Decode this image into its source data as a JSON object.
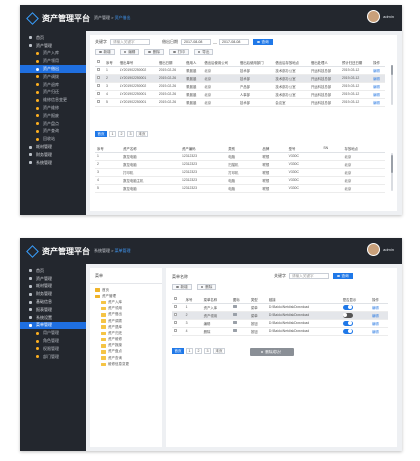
{
  "app": {
    "logo_text": "资产管理平台",
    "user_name": "admin"
  },
  "panel1": {
    "breadcrumb": {
      "parent": "资产管理",
      "sep": " > ",
      "current": "资产借出"
    },
    "sidebar": [
      {
        "label": "首页",
        "sub": false,
        "active": false
      },
      {
        "label": "资产管理",
        "sub": false,
        "active": false
      },
      {
        "label": "资产入库",
        "sub": true,
        "active": false
      },
      {
        "label": "资产领用",
        "sub": true,
        "active": false
      },
      {
        "label": "资产借出",
        "sub": true,
        "active": true
      },
      {
        "label": "资产调拨",
        "sub": true,
        "active": false
      },
      {
        "label": "资产退库",
        "sub": true,
        "active": false
      },
      {
        "label": "资产归还",
        "sub": true,
        "active": false
      },
      {
        "label": "维修信息变更",
        "sub": true,
        "active": false
      },
      {
        "label": "资产维修",
        "sub": true,
        "active": false
      },
      {
        "label": "资产报废",
        "sub": true,
        "active": false
      },
      {
        "label": "资产盘点",
        "sub": true,
        "active": false
      },
      {
        "label": "资产查询",
        "sub": true,
        "active": false
      },
      {
        "label": "回收站",
        "sub": true,
        "active": false
      },
      {
        "label": "耗材管理",
        "sub": false,
        "active": false
      },
      {
        "label": "财务管理",
        "sub": false,
        "active": false
      },
      {
        "label": "系统管理",
        "sub": false,
        "active": false
      }
    ],
    "filter": {
      "keyword_label": "关键字",
      "keyword_placeholder": "请输入关键字",
      "date_label": "借出日期",
      "date_from": "2017-08-08",
      "date_sep": "—",
      "date_to": "2017-08-08",
      "search_label": "查询"
    },
    "toolbar": [
      "新增",
      "编辑",
      "删除",
      "打印",
      "导出"
    ],
    "table1": {
      "headers": [
        "",
        "序号",
        "借出单号",
        "借出日期",
        "借用人",
        "借出后使用公司",
        "借出后使用部门",
        "借出后存放地点",
        "借出处理人",
        "预计归还日期",
        "操作"
      ],
      "rows": [
        [
          "1",
          "LY201902250002",
          "2019-02-26",
          "董晨晨",
          "北京",
          "技术部",
          "技术部办公室",
          "开运科技总部",
          "2019-03-12",
          "编辑"
        ],
        [
          "2",
          "LY201902250001",
          "2019-02-26",
          "董晨晨",
          "北京",
          "技术部",
          "技术部办公室",
          "开运科技总部",
          "2019-03-12",
          "编辑"
        ],
        [
          "3",
          "LY201902250002",
          "2019-02-26",
          "董晨晨",
          "北京",
          "产品部",
          "技术部办公室",
          "开运科技总部",
          "2019-03-12",
          "编辑"
        ],
        [
          "4",
          "LY201902250001",
          "2019-02-26",
          "董晨晨",
          "北京",
          "人事部",
          "技术部办公室",
          "开运科技总部",
          "2019-03-12",
          "编辑"
        ],
        [
          "5",
          "LY201902250001",
          "2019-02-26",
          "董晨晨",
          "北京",
          "技术部",
          "会议室",
          "开运科技总部",
          "2019-03-12",
          "编辑"
        ]
      ]
    },
    "pagination": {
      "prev": "首页",
      "pages": [
        "1",
        "2",
        "3"
      ],
      "next": "末页"
    },
    "table2": {
      "headers": [
        "序号",
        "资产名称",
        "资产编码",
        "类别",
        "品牌",
        "型号",
        "SN",
        "存放地点"
      ],
      "rows": [
        [
          "1",
          "数控电脑",
          "12312323",
          "电脑",
          "联想",
          "V330C",
          "",
          "北京"
        ],
        [
          "2",
          "数控电脑",
          "12312323",
          "扫描机",
          "联想",
          "V330C",
          "",
          "北京"
        ],
        [
          "3",
          "打印机",
          "12312323",
          "打印机",
          "联想",
          "V330C",
          "",
          "北京"
        ],
        [
          "4",
          "数控电脑主机",
          "12312323",
          "电脑",
          "联想",
          "V330C",
          "",
          "北京"
        ],
        [
          "5",
          "数控电脑",
          "12312323",
          "电脑",
          "联想",
          "V330C",
          "",
          "北京"
        ]
      ]
    }
  },
  "panel2": {
    "breadcrumb": {
      "parent": "系统管理",
      "sep": " > ",
      "current": "菜单管理"
    },
    "sidebar": [
      {
        "label": "首页",
        "sub": false,
        "active": false
      },
      {
        "label": "资产管理",
        "sub": false,
        "active": false
      },
      {
        "label": "耗材管理",
        "sub": false,
        "active": false
      },
      {
        "label": "财务管理",
        "sub": false,
        "active": false
      },
      {
        "label": "基础信息",
        "sub": false,
        "active": false
      },
      {
        "label": "报表管理",
        "sub": false,
        "active": false
      },
      {
        "label": "系统设置",
        "sub": false,
        "active": false
      },
      {
        "label": "菜单管理",
        "sub": false,
        "active": true
      },
      {
        "label": "用户管理",
        "sub": true,
        "active": false
      },
      {
        "label": "角色管理",
        "sub": true,
        "active": false
      },
      {
        "label": "权限管理",
        "sub": true,
        "active": false
      },
      {
        "label": "部门管理",
        "sub": true,
        "active": false
      }
    ],
    "tree": {
      "title": "菜单",
      "nodes": [
        {
          "label": "首页",
          "level": 0
        },
        {
          "label": "资产管理",
          "level": 0
        },
        {
          "label": "资产入库",
          "level": 1
        },
        {
          "label": "资产领用",
          "level": 1
        },
        {
          "label": "资产借出",
          "level": 1
        },
        {
          "label": "资产调拨",
          "level": 1
        },
        {
          "label": "资产退库",
          "level": 1
        },
        {
          "label": "资产归还",
          "level": 1
        },
        {
          "label": "资产维修",
          "level": 1
        },
        {
          "label": "资产报废",
          "level": 1
        },
        {
          "label": "资产盘点",
          "level": 1
        },
        {
          "label": "资产查询",
          "level": 1
        },
        {
          "label": "维修信息变更",
          "level": 1
        }
      ]
    },
    "menu_title": "菜单名称",
    "search": {
      "label": "关键字",
      "placeholder": "请输入关键字",
      "button": "查询"
    },
    "toolbar": [
      "新增",
      "删除"
    ],
    "table": {
      "headers": [
        "",
        "序号",
        "菜单名称",
        "图标",
        "类型",
        "链接",
        "是否显示",
        "操作"
      ],
      "rows": [
        {
          "no": "1",
          "name": "资产入库",
          "type": "菜单",
          "link": "D:\\Baidu\\NetdiskDownload",
          "show": true,
          "op": "编辑"
        },
        {
          "no": "2",
          "name": "资产领用",
          "type": "菜单",
          "link": "D:\\Baidu\\NetdiskDownload",
          "show": false,
          "op": "编辑"
        },
        {
          "no": "3",
          "name": "编辑",
          "type": "按钮",
          "link": "D:\\Baidu\\NetdiskDownload",
          "show": true,
          "op": "编辑"
        },
        {
          "no": "4",
          "name": "删除",
          "type": "按钮",
          "link": "D:\\Baidu\\NetdiskDownload",
          "show": true,
          "op": "编辑"
        }
      ]
    },
    "pagination": {
      "prev": "首页",
      "pages": [
        "1",
        "2",
        "3"
      ],
      "next": "末页"
    },
    "toast": "删除成功！",
    "colors": {
      "accent": "#1f78e8",
      "sidebar": "#23272e",
      "active": "#1f6fe0"
    }
  }
}
